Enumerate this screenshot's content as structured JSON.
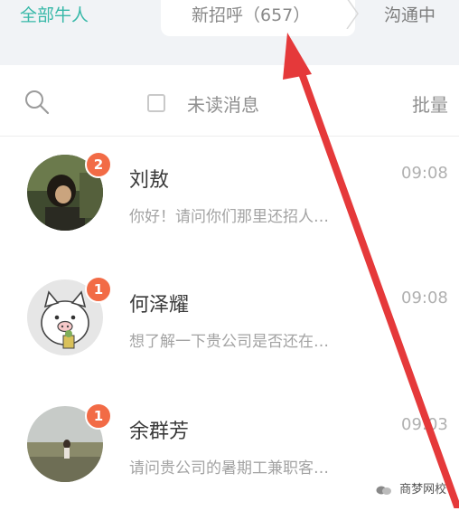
{
  "tabs": {
    "all": "全部牛人",
    "new_greetings": "新招呼（657）",
    "chatting": "沟通中"
  },
  "filter": {
    "unread_label": "未读消息",
    "batch_label": "批量"
  },
  "conversations": [
    {
      "name": "刘敖",
      "time": "09:08",
      "preview": "你好！请问你们那里还招人…",
      "badge": "2",
      "avatar": "photo-avatar-dark"
    },
    {
      "name": "何泽耀",
      "time": "09:08",
      "preview": "想了解一下贵公司是否还在…",
      "badge": "1",
      "avatar": "pig-cartoon-avatar"
    },
    {
      "name": "余群芳",
      "time": "09:03",
      "preview": "请问贵公司的暑期工兼职客…",
      "badge": "1",
      "avatar": "field-photo-avatar"
    }
  ],
  "watermark": "商梦网校",
  "colors": {
    "accent": "#37b8a8",
    "badge": "#f26b46",
    "arrow": "#e5393a"
  }
}
